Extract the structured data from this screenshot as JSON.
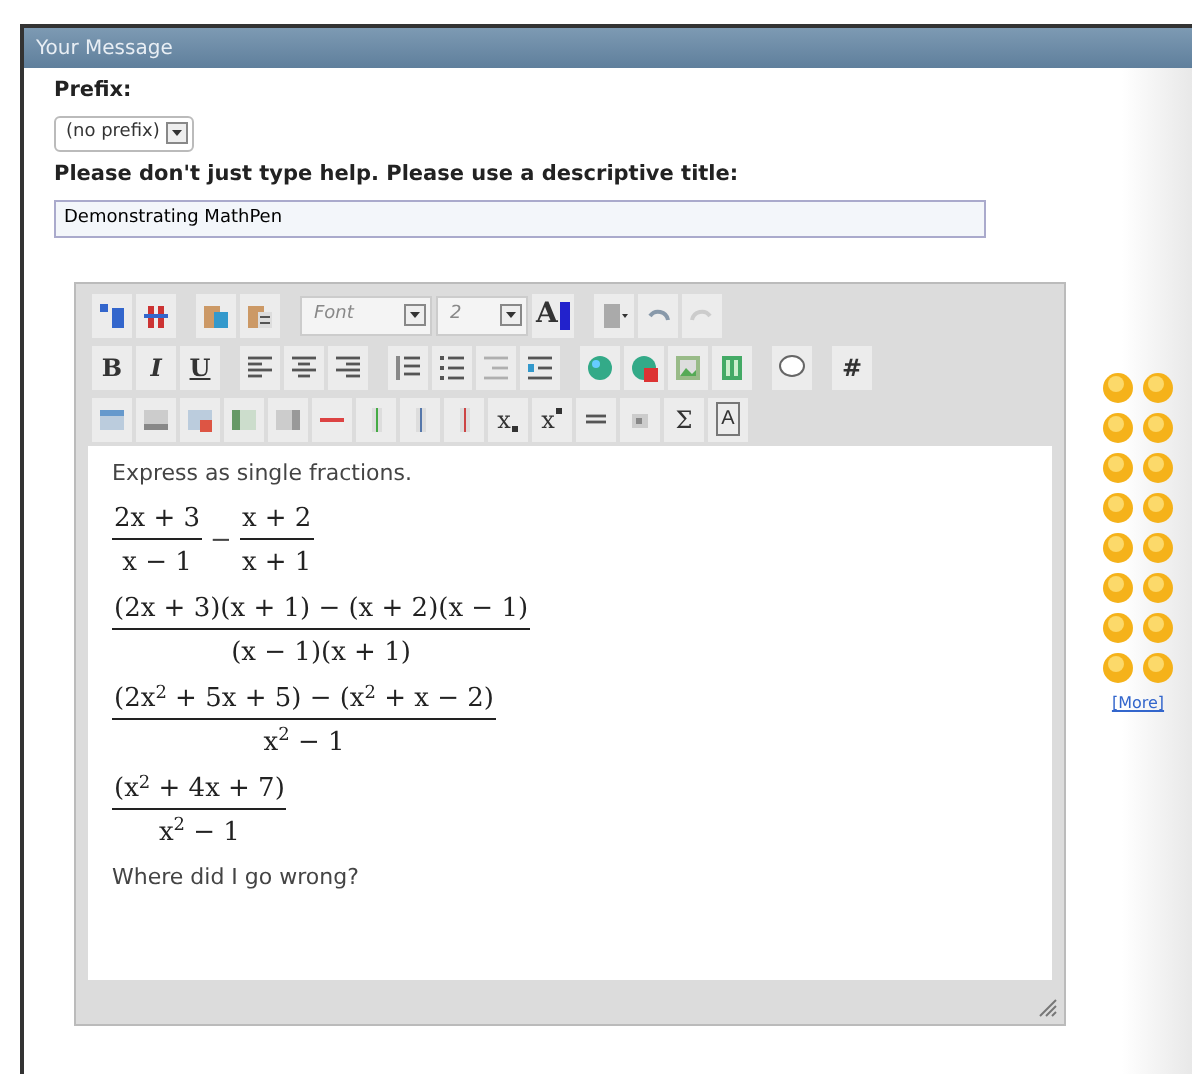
{
  "panel": {
    "title": "Your Message"
  },
  "prefix": {
    "label": "Prefix:",
    "value": "(no prefix)"
  },
  "title_field": {
    "label": "Please don't just type help. Please use a descriptive title:",
    "value": "Demonstrating MathPen"
  },
  "toolbar": [
    [
      {
        "kind": "icon"
      },
      {
        "kind": "icon"
      },
      {
        "kind": "sep"
      },
      {
        "kind": "icon"
      },
      {
        "kind": "icon"
      },
      {
        "kind": "sep"
      },
      {
        "kind": "select",
        "text": "Font"
      },
      {
        "kind": "select",
        "text": "2"
      },
      {
        "kind": "text",
        "text": "A"
      },
      {
        "kind": "sep"
      },
      {
        "kind": "icon"
      },
      {
        "kind": "icon"
      },
      {
        "kind": "icon"
      }
    ],
    [
      {
        "kind": "text",
        "text": "B"
      },
      {
        "kind": "text",
        "text": "I"
      },
      {
        "kind": "text",
        "text": "U"
      },
      {
        "kind": "sep"
      },
      {
        "kind": "icon"
      },
      {
        "kind": "icon"
      },
      {
        "kind": "icon"
      },
      {
        "kind": "sep"
      },
      {
        "kind": "icon"
      },
      {
        "kind": "icon"
      },
      {
        "kind": "icon"
      },
      {
        "kind": "icon"
      },
      {
        "kind": "sep"
      },
      {
        "kind": "icon"
      },
      {
        "kind": "icon"
      },
      {
        "kind": "icon"
      },
      {
        "kind": "icon"
      },
      {
        "kind": "sep"
      },
      {
        "kind": "icon"
      },
      {
        "kind": "sep"
      },
      {
        "kind": "text",
        "text": "#"
      }
    ],
    [
      {
        "kind": "icon"
      },
      {
        "kind": "icon"
      },
      {
        "kind": "icon"
      },
      {
        "kind": "icon"
      },
      {
        "kind": "icon"
      },
      {
        "kind": "icon"
      },
      {
        "kind": "icon"
      },
      {
        "kind": "icon"
      },
      {
        "kind": "icon"
      },
      {
        "kind": "text",
        "text": "x"
      },
      {
        "kind": "text",
        "text": "x"
      },
      {
        "kind": "icon"
      },
      {
        "kind": "icon"
      },
      {
        "kind": "text",
        "text": "Σ"
      },
      {
        "kind": "text",
        "text": "A"
      }
    ]
  ],
  "content": [
    {
      "kind": "text",
      "text": "Express as single fractions."
    },
    {
      "kind": "math",
      "terms": [
        {
          "kind": "fraction",
          "numerator": "2x + 3",
          "denominator": "x − 1"
        },
        {
          "kind": "operator",
          "text": "−"
        },
        {
          "kind": "fraction",
          "numerator": "x + 2",
          "denominator": "x + 1"
        }
      ]
    },
    {
      "kind": "math",
      "terms": [
        {
          "kind": "fraction",
          "numerator": "(2x + 3)(x + 1) − (x + 2)(x − 1)",
          "denominator": "(x − 1)(x + 1)"
        }
      ]
    },
    {
      "kind": "math",
      "terms": [
        {
          "kind": "fraction",
          "numerator": "(2x$^{2}$ + 5x + 5) − (x$^{2}$ + x − 2)",
          "denominator": "x$^{2}$ − 1"
        }
      ]
    },
    {
      "kind": "math",
      "terms": [
        {
          "kind": "fraction",
          "numerator": "(x$^{2}$ + 4x + 7)",
          "denominator": "x$^{2}$ − 1"
        }
      ]
    },
    {
      "kind": "text",
      "text": "Where did I go wrong?"
    }
  ],
  "smilies": {
    "items": [
      {
        "kind": "smiley"
      },
      {
        "kind": "smiley"
      },
      {
        "kind": "smiley"
      },
      {
        "kind": "smiley"
      },
      {
        "kind": "smiley"
      },
      {
        "kind": "smiley"
      },
      {
        "kind": "smiley"
      },
      {
        "kind": "smiley"
      },
      {
        "kind": "smiley"
      },
      {
        "kind": "smiley"
      },
      {
        "kind": "smiley"
      },
      {
        "kind": "smiley"
      },
      {
        "kind": "smiley"
      },
      {
        "kind": "smiley"
      },
      {
        "kind": "smiley"
      },
      {
        "kind": "smiley"
      }
    ],
    "more": "[More]"
  }
}
